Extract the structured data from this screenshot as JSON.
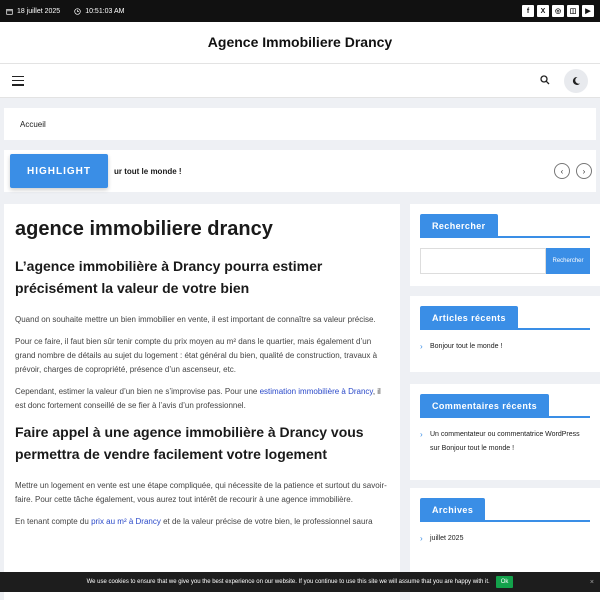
{
  "topbar": {
    "date": "18 juillet 2025",
    "time": "10:51:03 AM",
    "socials": [
      "f",
      "X",
      "◎",
      "◫",
      "▶"
    ]
  },
  "site": {
    "title": "Agence Immobiliere Drancy"
  },
  "breadcrumb": {
    "home": "Accueil"
  },
  "ticker": {
    "label": "HIGHLIGHT",
    "text": "ur tout le monde !",
    "prev": "‹",
    "next": "›"
  },
  "article": {
    "title": "agence immobiliere drancy",
    "h2_1": "L’agence immobilière à Drancy pourra estimer précisément la valeur de votre bien",
    "p1": "Quand on souhaite mettre un bien immobilier en vente, il est important de connaître sa valeur précise.",
    "p2": "Pour ce faire, il faut bien sûr tenir compte du prix moyen au m² dans le quartier, mais également d’un grand nombre de détails au sujet du logement : état général du bien, qualité de construction, travaux à prévoir, charges de copropriété, présence d’un ascenseur, etc.",
    "p3_before": "Cependant, estimer la valeur d’un bien ne s’improvise pas. Pour une ",
    "p3_link": "estimation immobilière à Drancy",
    "p3_after": ", il est donc fortement conseillé de se fier à l’avis d’un professionnel.",
    "h2_2": "Faire appel à une agence immobilière à Drancy vous permettra de vendre facilement votre logement",
    "p4": "Mettre un logement en vente est une étape compliquée, qui nécessite de la patience et surtout du savoir-faire. Pour cette tâche également, vous aurez tout intérêt de recourir à une agence immobilière.",
    "p5_before": "En tenant compte du ",
    "p5_link": "prix au m² à Drancy",
    "p5_after": " et de la valeur précise de votre bien, le professionnel saura"
  },
  "sidebar": {
    "search": {
      "title": "Rechercher",
      "button": "Rechercher",
      "placeholder": ""
    },
    "recent_posts": {
      "title": "Articles récents",
      "items": [
        "Bonjour tout le monde !"
      ]
    },
    "recent_comments": {
      "title": "Commentaires récents",
      "author": "Un commentateur ou commentatrice WordPress",
      "on": " sur ",
      "post": "Bonjour tout le monde !"
    },
    "archives": {
      "title": "Archives",
      "items": [
        "juillet 2025"
      ]
    }
  },
  "cookie": {
    "text": "We use cookies to ensure that we give you the best experience on our website. If you continue to use this site we will assume that you are happy with it.",
    "ok": "Ok",
    "close": "×"
  },
  "colors": {
    "accent": "#3a8ee6",
    "topbar": "#111111",
    "cookie_ok": "#13a24b"
  }
}
